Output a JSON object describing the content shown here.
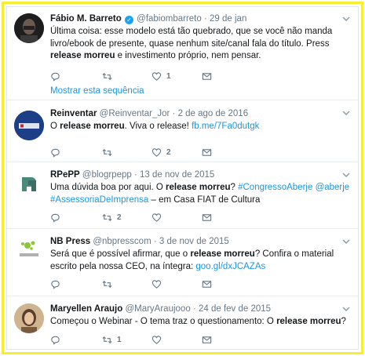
{
  "tweets": [
    {
      "name": "Fábio M. Barreto",
      "handle": "@fabiombarreto",
      "sep": "·",
      "date": "29 de jan",
      "verified": true,
      "text_parts": [
        "Última coisa: esse modelo está tão quebrado, que se você não manda livro/ebook de presente, quase nenhum site/canal fala do título. Press ",
        "release morreu",
        " e investimento próprio, nem pensar."
      ],
      "likes": "1",
      "retweets": "",
      "thread_link": "Mostrar esta sequência"
    },
    {
      "name": "Reinventar",
      "handle": "@Reinventar_Jor",
      "sep": "·",
      "date": "2 de ago de 2016",
      "text_parts": [
        "O ",
        "release morreu",
        ". Viva o release! ",
        "fb.me/7Fa0dutgk"
      ],
      "likes": "2",
      "retweets": ""
    },
    {
      "name": "RPePP",
      "handle": "@blogrpepp",
      "sep": "·",
      "date": "13 de nov de 2015",
      "text_parts": [
        "Uma dúvida boa por aqui. O ",
        "release morreu",
        "? ",
        "#CongressoAberje",
        " ",
        "@aberje",
        " ",
        "#AssessoriaDeImprensa",
        " – em Casa FIAT de Cultura"
      ],
      "likes": "",
      "retweets": "2"
    },
    {
      "name": "NB Press",
      "handle": "@nbpresscom",
      "sep": "·",
      "date": "3 de nov de 2015",
      "text_parts": [
        "Será que é possível afirmar, que o ",
        "release morreu",
        "? Confira o material escrito pela nossa CEO, na íntegra: ",
        "goo.gl/dxJCAZAs"
      ],
      "likes": "",
      "retweets": ""
    },
    {
      "name": "Maryellen Araujo",
      "handle": "@MaryAraujooo",
      "sep": "·",
      "date": "24 de fev de 2015",
      "text_parts": [
        "Começou o Webinar - O tema traz o questionamento: O ",
        "release morreu",
        "?"
      ],
      "likes": "",
      "retweets": "1"
    }
  ],
  "icons": [
    "reply-icon",
    "retweet-icon",
    "like-icon",
    "message-icon",
    "caret-down-icon",
    "verified-icon"
  ],
  "colors": {
    "border": "#f7ee2e",
    "link": "#1b95e0",
    "muted": "#657786",
    "verified": "#1da1f2"
  }
}
